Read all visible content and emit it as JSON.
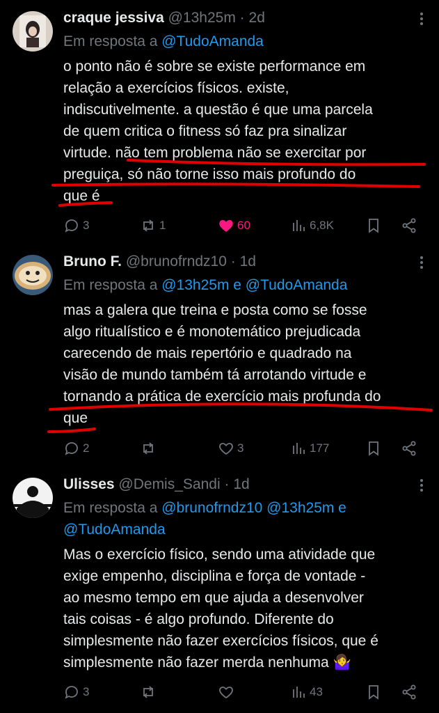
{
  "tweets": [
    {
      "name": "craque jessiva",
      "handle": "@13h25m",
      "time": "2d",
      "reply_prefix": "Em resposta a ",
      "reply_to": "@TudoAmanda",
      "lines": [
        "o ponto não é sobre se existe performance em",
        "relação a exercícios físicos. existe,",
        "indiscutivelmente. a questão é que uma parcela",
        "de quem critica o fitness só faz pra sinalizar",
        "virtude. não tem problema não se exercitar por",
        "preguiça, só não torne isso mais profundo do",
        "que é"
      ],
      "replies": "3",
      "reposts": "1",
      "likes": "60",
      "views": "6,8K",
      "liked": true
    },
    {
      "name": "Bruno F.",
      "handle": "@brunofrndz10",
      "time": "1d",
      "reply_prefix": "Em resposta a ",
      "reply_to": "@13h25m e @TudoAmanda",
      "lines": [
        "mas a galera que treina e posta como se fosse",
        "algo ritualístico e é monotemático prejudicada",
        "carecendo de mais repertório e quadrado na",
        "visão de mundo também tá arrotando virtude e",
        "tornando a prática de exercício mais profunda do",
        "que"
      ],
      "replies": "2",
      "reposts": "",
      "likes": "3",
      "views": "177",
      "liked": false
    },
    {
      "name": "Ulisses",
      "handle": "@Demis_Sandi",
      "time": "1d",
      "reply_prefix": "Em resposta a ",
      "reply_to_line1": "@brunofrndz10 @13h25m e",
      "reply_to_line2": "@TudoAmanda",
      "lines": [
        "Mas o exercício físico, sendo uma atividade que",
        "exige empenho, disciplina e força de vontade -",
        "ao mesmo tempo em que ajuda a desenvolver",
        "tais coisas - é algo profundo. Diferente do",
        "simplesmente não fazer exercícios físicos, que é",
        "simplesmente não fazer merda nenhuma 🤷‍♀️"
      ],
      "replies": "3",
      "reposts": "",
      "likes": "",
      "views": "43",
      "liked": false
    }
  ],
  "colors": {
    "link": "#1d9bf0",
    "muted": "#71767b",
    "like": "#f91880",
    "annotation": "#e00000"
  }
}
